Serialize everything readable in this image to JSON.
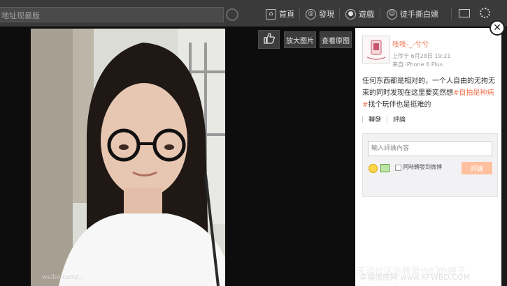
{
  "topnav": {
    "search_placeholder": "地址现最版",
    "items": [
      {
        "icon": "home-icon",
        "label": "首頁"
      },
      {
        "icon": "discover-icon",
        "label": "發現"
      },
      {
        "icon": "game-icon",
        "label": "遊戲"
      },
      {
        "icon": "user-icon",
        "label": "徒手撕白嫖"
      }
    ],
    "mail_icon": "mail-icon",
    "settings_icon": "gear-icon"
  },
  "toolbar": {
    "like_icon": "thumbs-up-icon",
    "enlarge_label": "放大图片",
    "original_label": "查看原图"
  },
  "post": {
    "username": "吱吱-_-兮兮",
    "time": "上传于 6月28日 19:21",
    "source": "来自 iPhone 6 Plus",
    "text_before": "任何东西都是相对的，一个人自由的无拘无束的同时发现在这里要奕然想",
    "hashtag": "#自拍是种病#",
    "text_after": "找个玩伴也是挺难的",
    "forward_label": "轉發",
    "comment_label": "評論",
    "comment_placeholder": "輸入評論內容",
    "also_forward_label": "同時轉發到微博",
    "reply_label": "評論"
  },
  "photo": {
    "watermark": "weibo.com/..."
  },
  "watermarks": {
    "site": "幸福情感网 www.XFWBD.COM",
    "faint": "天涯社区@我是你们的嫂子"
  },
  "colors": {
    "accent": "#eb7350",
    "nav_bg": "#3a3a3a",
    "overlay_bg": "#0d0d0d",
    "reply_btn": "#ffc09f"
  }
}
